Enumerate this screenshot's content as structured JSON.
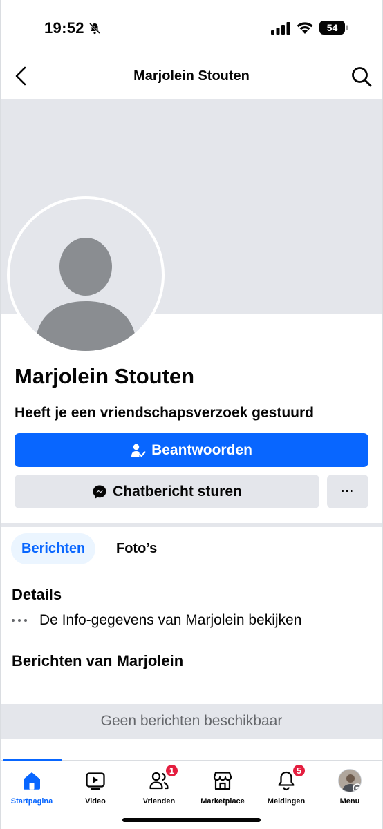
{
  "status_bar": {
    "time": "19:52",
    "battery": "54"
  },
  "header": {
    "title": "Marjolein Stouten"
  },
  "profile": {
    "name": "Marjolein Stouten",
    "request_text": "Heeft je een vriendschapsverzoek gestuurd",
    "respond_button": "Beantwoorden",
    "message_button": "Chatbericht sturen",
    "more_button": "···"
  },
  "tabs": [
    {
      "label": "Berichten",
      "active": true
    },
    {
      "label": "Foto’s",
      "active": false
    }
  ],
  "details": {
    "title": "Details",
    "info_row": "De Info-gegevens van Marjolein bekijken"
  },
  "posts": {
    "title": "Berichten van Marjolein",
    "empty": "Geen berichten beschikbaar"
  },
  "bottom_nav": {
    "items": [
      {
        "label": "Startpagina",
        "icon": "home-icon",
        "active": true
      },
      {
        "label": "Video",
        "icon": "video-icon"
      },
      {
        "label": "Vrienden",
        "icon": "friends-icon",
        "badge": "1"
      },
      {
        "label": "Marketplace",
        "icon": "marketplace-icon"
      },
      {
        "label": "Meldingen",
        "icon": "bell-icon",
        "badge": "5"
      },
      {
        "label": "Menu",
        "icon": "menu-avatar"
      }
    ]
  },
  "colors": {
    "primary": "#0866ff",
    "secondary_bg": "#e4e6eb",
    "badge": "#e41e3f"
  }
}
